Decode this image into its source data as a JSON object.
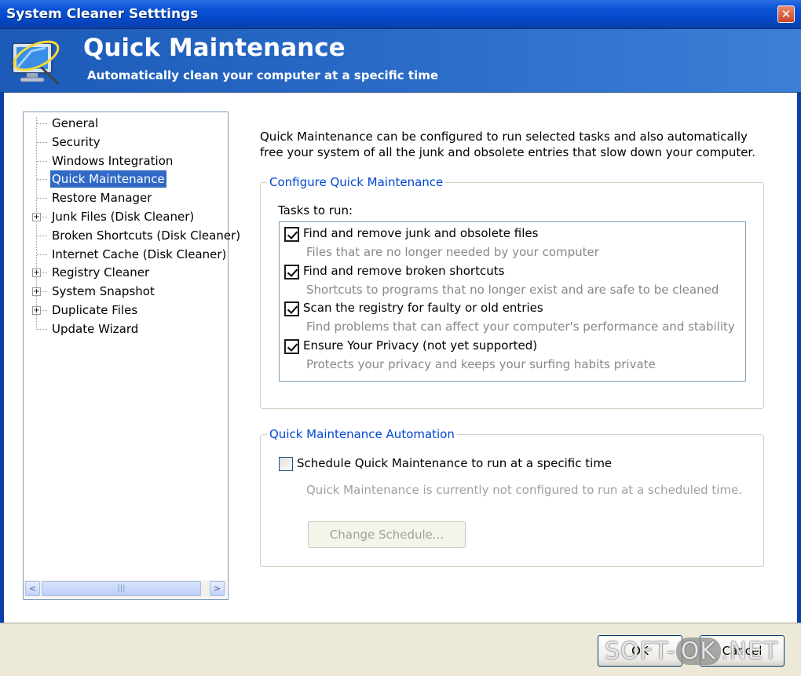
{
  "window": {
    "title": "System Cleaner Setttings",
    "close_glyph": "✕"
  },
  "header": {
    "title": "Quick Maintenance",
    "subtitle": "Automatically clean your computer at a specific time",
    "logo_icon": "monitor-cleaner-icon"
  },
  "tree": {
    "items": [
      {
        "label": "General",
        "expandable": false,
        "selected": false
      },
      {
        "label": "Security",
        "expandable": false,
        "selected": false
      },
      {
        "label": "Windows Integration",
        "expandable": false,
        "selected": false
      },
      {
        "label": "Quick Maintenance",
        "expandable": false,
        "selected": true
      },
      {
        "label": "Restore Manager",
        "expandable": false,
        "selected": false
      },
      {
        "label": "Junk Files (Disk Cleaner)",
        "expandable": true,
        "selected": false
      },
      {
        "label": "Broken Shortcuts (Disk Cleaner)",
        "expandable": false,
        "selected": false
      },
      {
        "label": "Internet Cache (Disk Cleaner)",
        "expandable": false,
        "selected": false
      },
      {
        "label": "Registry Cleaner",
        "expandable": true,
        "selected": false
      },
      {
        "label": "System Snapshot",
        "expandable": true,
        "selected": false
      },
      {
        "label": "Duplicate Files",
        "expandable": true,
        "selected": false
      },
      {
        "label": "Update Wizard",
        "expandable": false,
        "selected": false
      }
    ],
    "expander_glyph": "+",
    "scroll_left": "<",
    "scroll_right": ">",
    "scroll_grip": "|||"
  },
  "content": {
    "description": "Quick Maintenance can be configured to run selected tasks and also automatically free your system of all the junk and obsolete entries that slow down your computer.",
    "configure": {
      "title": "Configure Quick Maintenance",
      "tasks_label": "Tasks to run:",
      "tasks": [
        {
          "name": "Find and remove junk and obsolete files",
          "desc": "Files that are no longer needed by your computer",
          "checked": true
        },
        {
          "name": "Find and remove broken shortcuts",
          "desc": "Shortcuts to programs that no longer exist and are safe to be cleaned",
          "checked": true
        },
        {
          "name": "Scan the registry for faulty or old entries",
          "desc": "Find problems that can affect your computer's performance and stability",
          "checked": true
        },
        {
          "name": "Ensure Your Privacy (not yet supported)",
          "desc": "Protects your privacy and keeps your surfing habits private",
          "checked": true
        }
      ]
    },
    "automation": {
      "title": "Quick Maintenance Automation",
      "schedule_label": "Schedule Quick Maintenance to run at a specific time",
      "schedule_checked": false,
      "status": "Quick Maintenance is currently not configured to run at a scheduled time.",
      "change_button": "Change Schedule..."
    }
  },
  "footer": {
    "ok_label": "OK",
    "cancel_label": "Cancel",
    "watermark_left": "SOFT-",
    "watermark_mid": "OK",
    "watermark_right": ".NET"
  },
  "colors": {
    "accent": "#0046d5",
    "selection": "#316ac5",
    "titlebar": "#0a54d8"
  }
}
